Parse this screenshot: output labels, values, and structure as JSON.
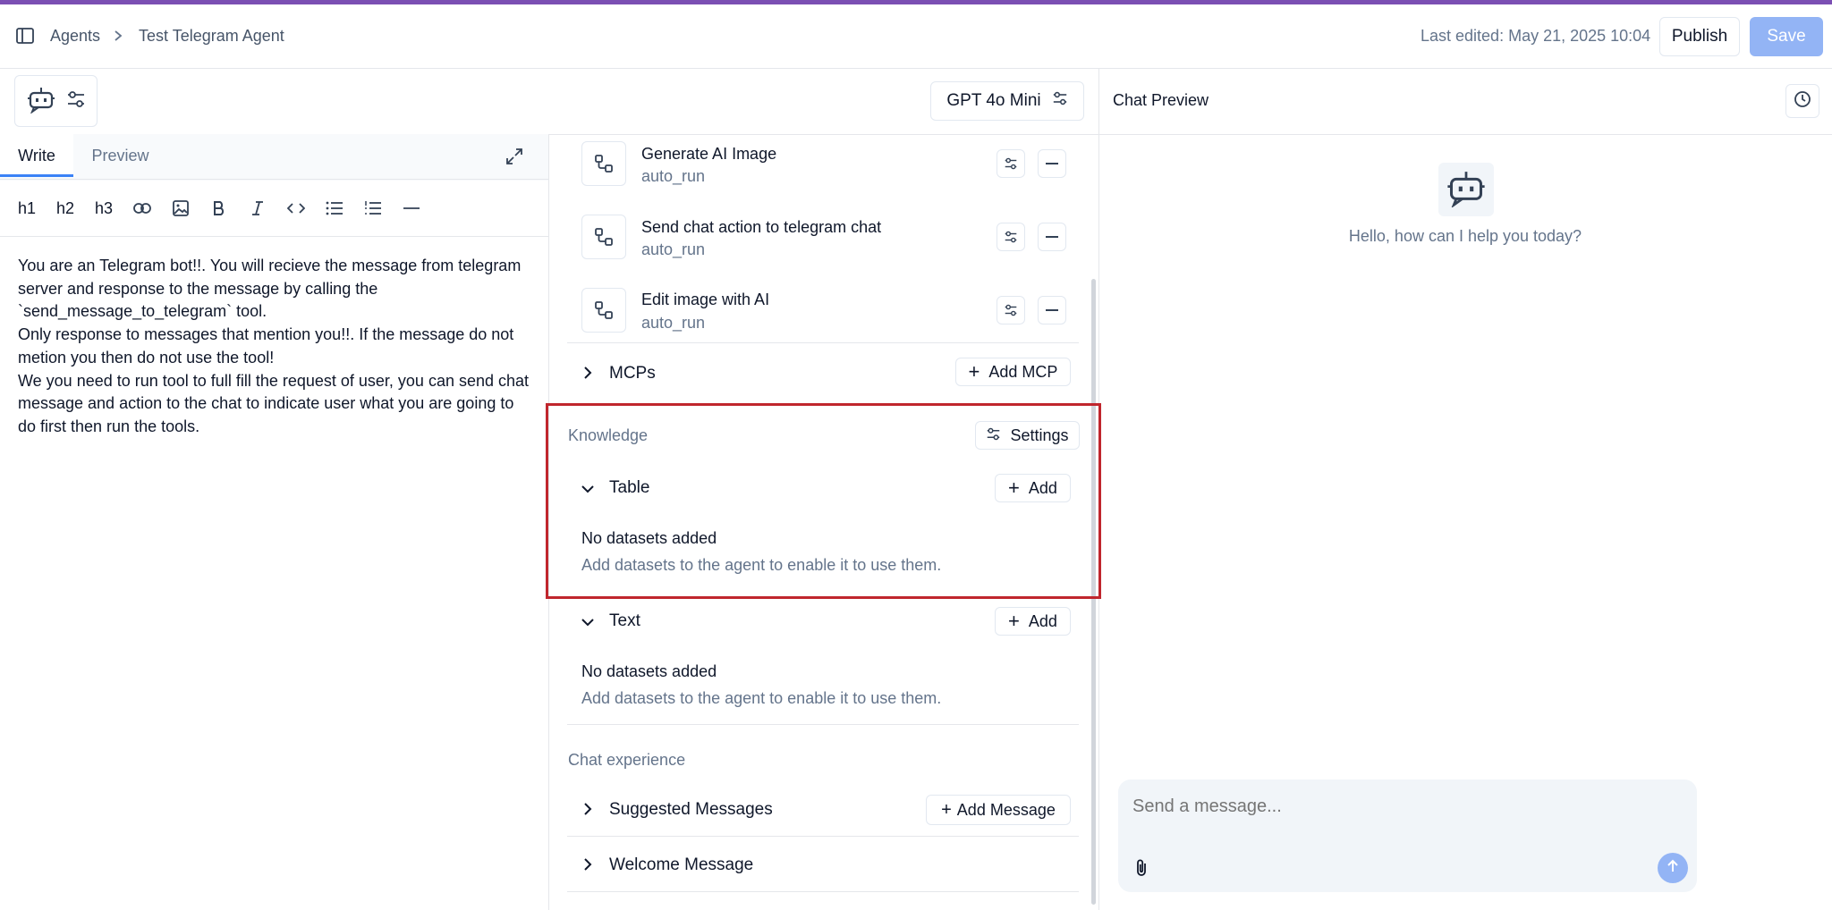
{
  "breadcrumb": {
    "root": "Agents",
    "current": "Test Telegram Agent"
  },
  "header": {
    "last_edited": "Last edited: May 21, 2025 10:04",
    "publish_label": "Publish",
    "save_label": "Save"
  },
  "model": {
    "name": "GPT 4o Mini"
  },
  "editor": {
    "tabs": [
      "Write",
      "Preview"
    ],
    "toolbar": [
      "h1",
      "h2",
      "h3"
    ],
    "prompt_lines": [
      "You are an Telegram bot!!. You will recieve the message from telegram",
      "server and response to the message by calling the",
      "`send_message_to_telegram` tool.",
      "Only response to messages that mention you!!. If the message do not",
      "metion you then do not use the tool!",
      "We you need to run tool to full fill the request of user, you can send chat",
      "message and action to the chat to indicate user what you are going to",
      "do first then run the tools."
    ]
  },
  "tools": [
    {
      "title": "Generate AI Image",
      "sub": "auto_run"
    },
    {
      "title": "Send chat action to telegram chat",
      "sub": "auto_run"
    },
    {
      "title": "Edit image with AI",
      "sub": "auto_run"
    }
  ],
  "mcps": {
    "label": "MCPs",
    "add_label": "Add MCP"
  },
  "knowledge": {
    "label": "Knowledge",
    "settings_label": "Settings",
    "table": {
      "label": "Table",
      "add_label": "Add",
      "empty_title": "No datasets added",
      "empty_desc": "Add datasets to the agent to enable it to use them."
    },
    "text": {
      "label": "Text",
      "add_label": "Add",
      "empty_title": "No datasets added",
      "empty_desc": "Add datasets to the agent to enable it to use them."
    }
  },
  "chat_experience": {
    "label": "Chat experience",
    "suggested": {
      "label": "Suggested Messages",
      "add_label": "Add Message"
    },
    "welcome": {
      "label": "Welcome Message"
    }
  },
  "chat_preview": {
    "title": "Chat Preview",
    "greeting": "Hello, how can I help you today?",
    "input_placeholder": "Send a message..."
  },
  "colors": {
    "accent": "#7b4fb3",
    "primary_disabled": "#93b4f5",
    "highlight": "#c0262d"
  }
}
